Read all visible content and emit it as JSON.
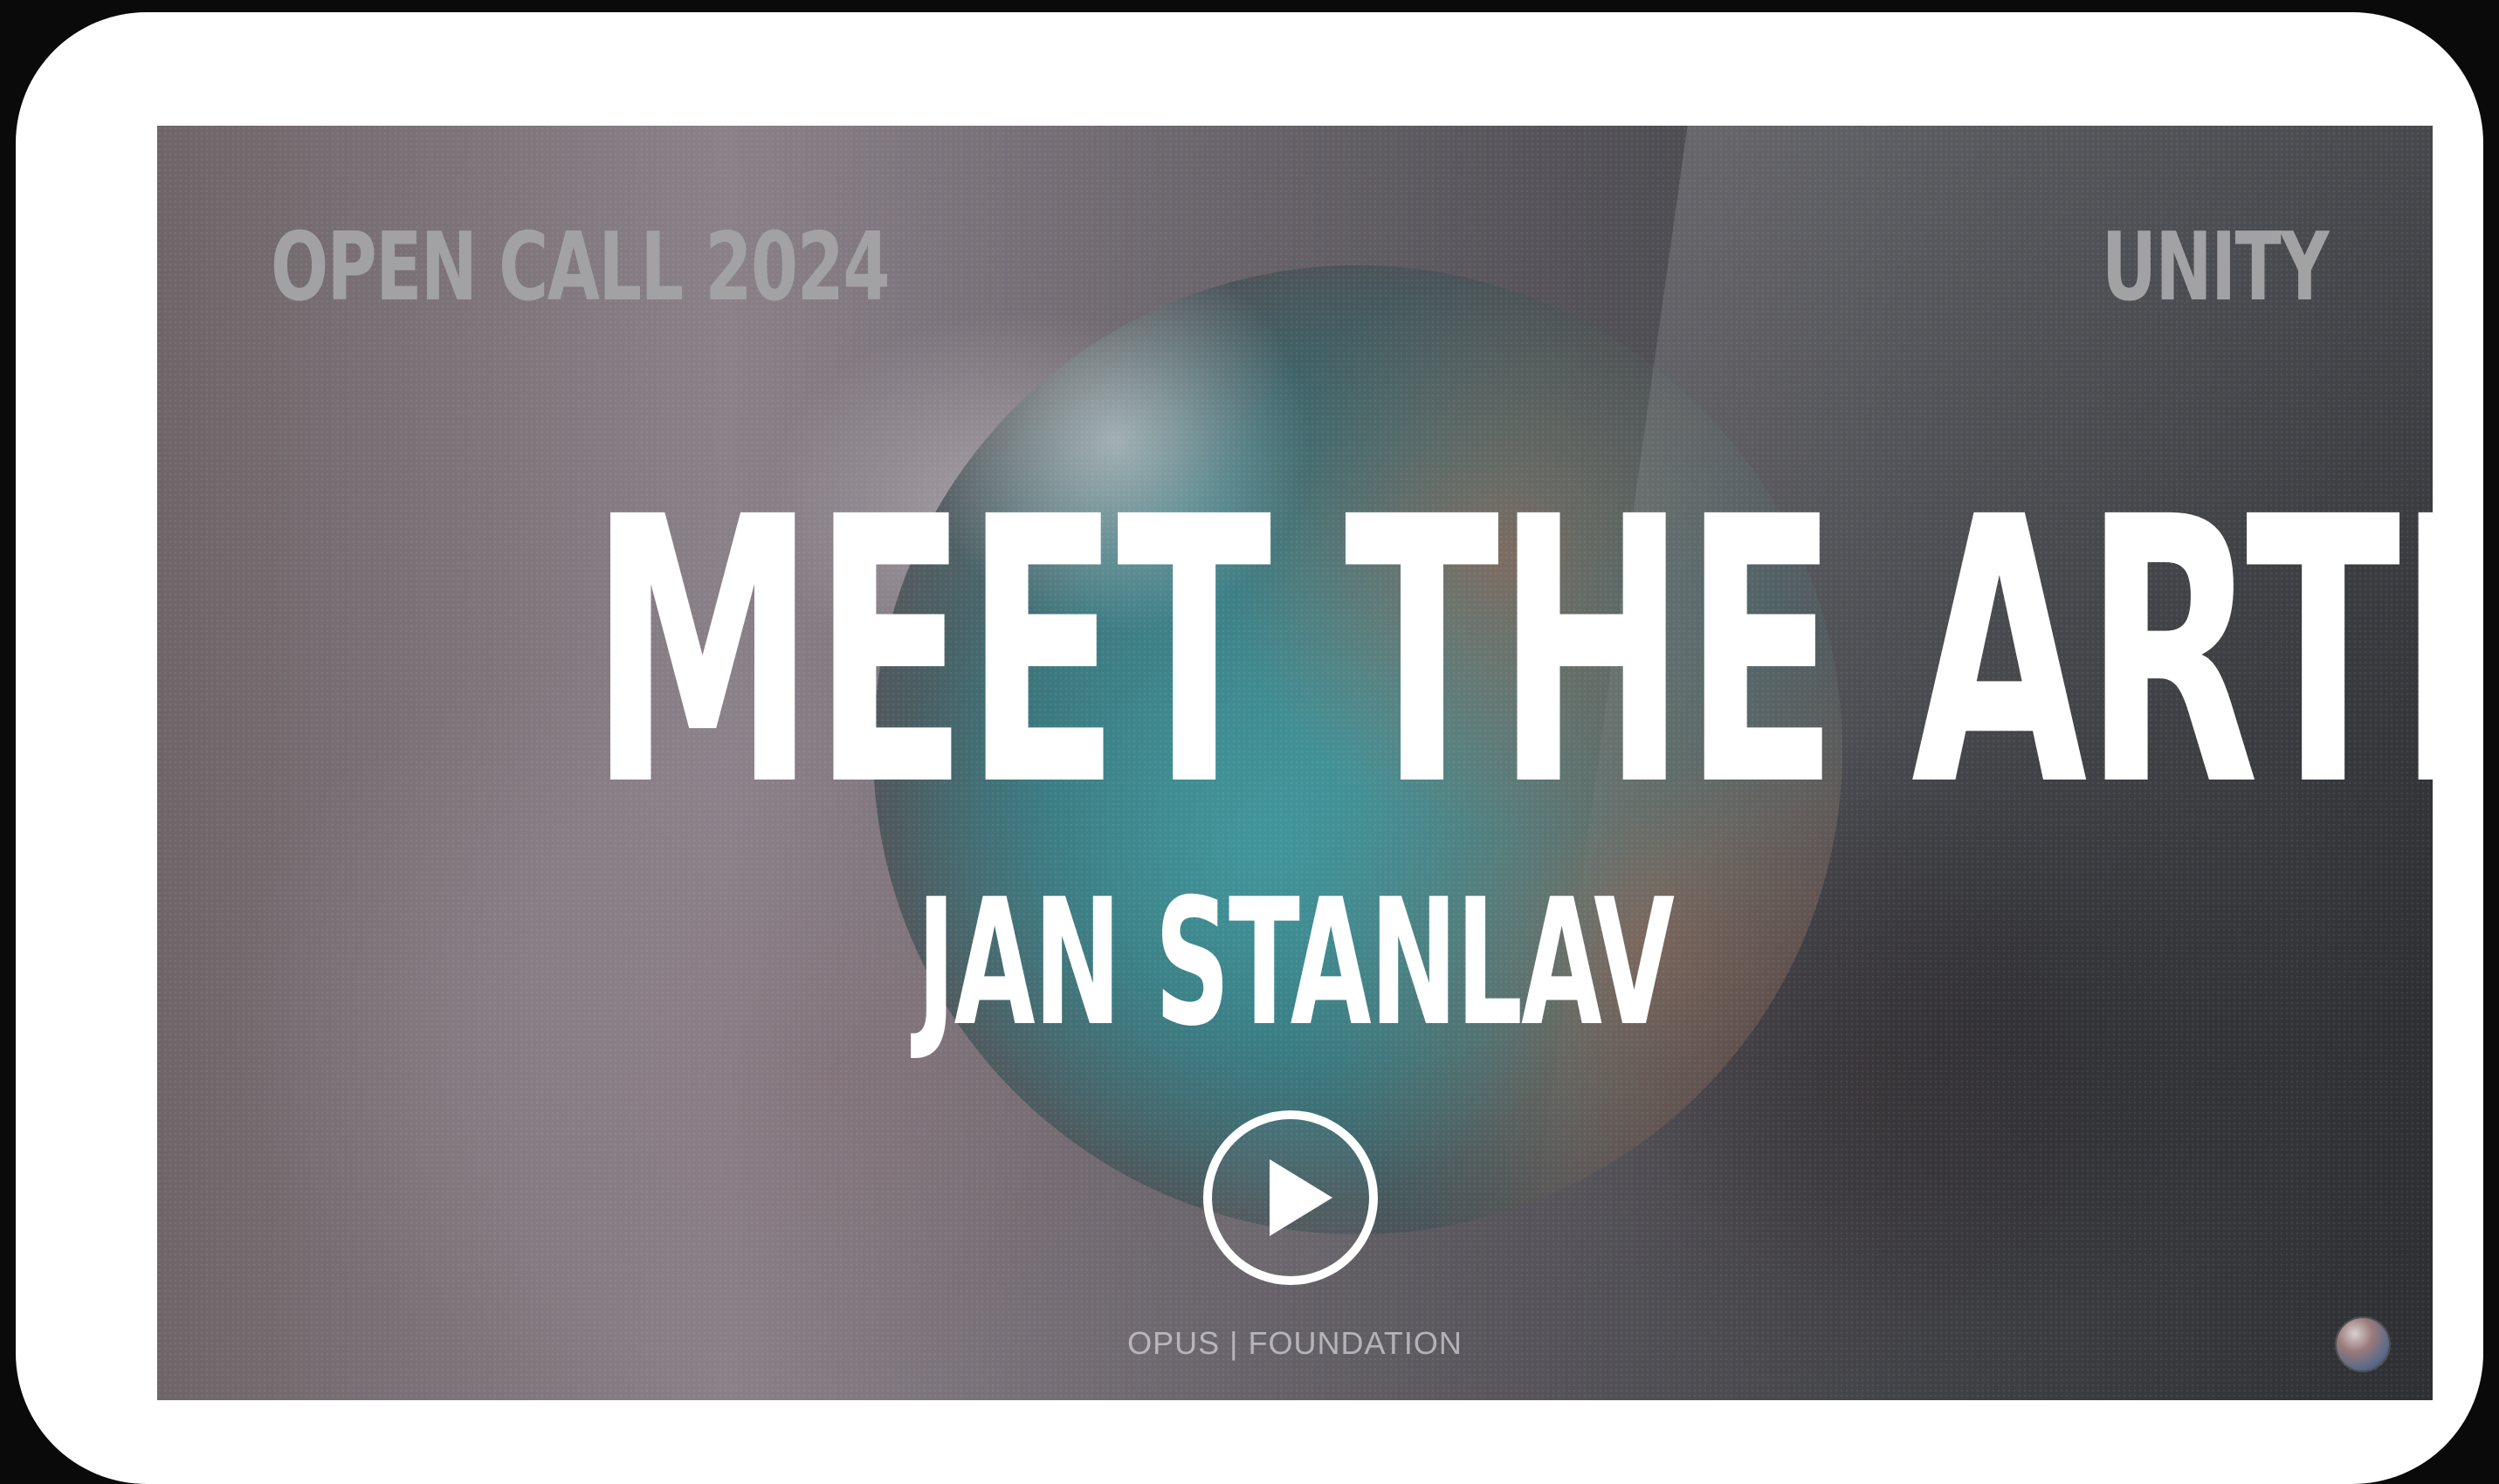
{
  "video": {
    "top_left_label": "OPEN CALL 2024",
    "top_right_label": "UNITY",
    "headline": "MEET THE ARTIST",
    "artist_name": "JAN STANLAV",
    "footer_brand": "OPUS | FOUNDATION",
    "play_icon": "play-icon",
    "corner_logo_icon": "planet-logo-icon"
  },
  "colors": {
    "card_background": "#ffffff",
    "page_background": "#0a0a0a",
    "headline_text": "#ffffff",
    "subtitle_text": "#a2a2a4"
  }
}
